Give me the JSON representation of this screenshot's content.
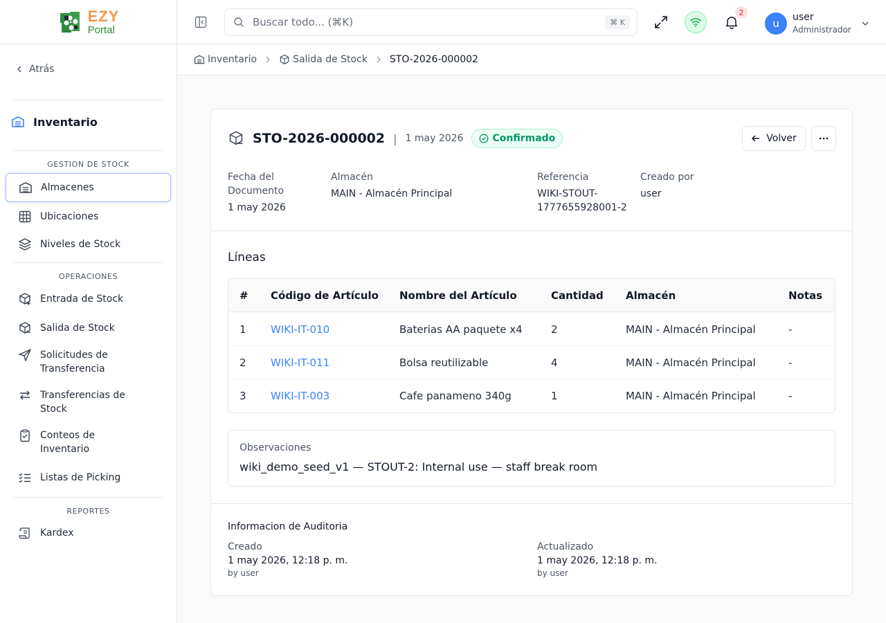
{
  "logo": {
    "ezy": "EZY",
    "portal": "Portal"
  },
  "sidebar": {
    "back_label": "Atrás",
    "module_title": "Inventario",
    "sections": {
      "stock": "GESTION DE STOCK",
      "operations": "OPERACIONES",
      "reports": "REPORTES"
    },
    "items": {
      "almacenes": "Almacenes",
      "ubicaciones": "Ubicaciones",
      "niveles": "Niveles de Stock",
      "entrada": "Entrada de Stock",
      "salida": "Salida de Stock",
      "solicitudes_1": "Solicitudes de",
      "solicitudes_2": "Transferencia",
      "transferencias_1": "Transferencias de",
      "transferencias_2": "Stock",
      "conteos_1": "Conteos de",
      "conteos_2": "Inventario",
      "picking": "Listas de Picking",
      "kardex": "Kardex"
    }
  },
  "topbar": {
    "search_placeholder": "Buscar todo... (⌘K)",
    "search_shortcut": "⌘ K",
    "notifications_count": "2",
    "user_initial": "u",
    "user_name": "user",
    "user_role": "Administrador"
  },
  "breadcrumb": {
    "root": "Inventario",
    "section": "Salida de Stock",
    "current": "STO-2026-000002"
  },
  "document": {
    "number": "STO-2026-000002",
    "separator": "|",
    "date": "1 may 2026",
    "status": "Confirmado",
    "back_button": "Volver",
    "fields": {
      "date_label_1": "Fecha del",
      "date_label_2": "Documento",
      "date_value": "1 may 2026",
      "warehouse_label": "Almacén",
      "warehouse_value": "MAIN - Almacén Principal",
      "reference_label": "Referencia",
      "reference_value_1": "WIKI-STOUT-",
      "reference_value_2": "1777655928001-2",
      "created_by_label": "Creado por",
      "created_by_value": "user"
    }
  },
  "lines": {
    "title": "Líneas",
    "columns": [
      "#",
      "Código de Artículo",
      "Nombre del Artículo",
      "Cantidad",
      "Almacén",
      "Notas"
    ],
    "rows": [
      [
        "1",
        "WIKI-IT-010",
        "Baterias AA paquete x4",
        "2",
        "MAIN - Almacén Principal",
        "-"
      ],
      [
        "2",
        "WIKI-IT-011",
        "Bolsa reutilizable",
        "4",
        "MAIN - Almacén Principal",
        "-"
      ],
      [
        "3",
        "WIKI-IT-003",
        "Cafe panameno 340g",
        "1",
        "MAIN - Almacén Principal",
        "-"
      ]
    ]
  },
  "observations": {
    "label": "Observaciones",
    "value": "wiki_demo_seed_v1 — STOUT-2: Internal use — staff break room"
  },
  "audit": {
    "title": "Informacion de Auditoria",
    "created_label": "Creado",
    "created_value": "1 may 2026, 12:18 p. m.",
    "created_by": "by user",
    "updated_label": "Actualizado",
    "updated_value": "1 may 2026, 12:18 p. m.",
    "updated_by": "by user"
  },
  "colors": {
    "accent": "#3b82f6",
    "status_green": "#059669",
    "notification_red": "#dc2626"
  }
}
